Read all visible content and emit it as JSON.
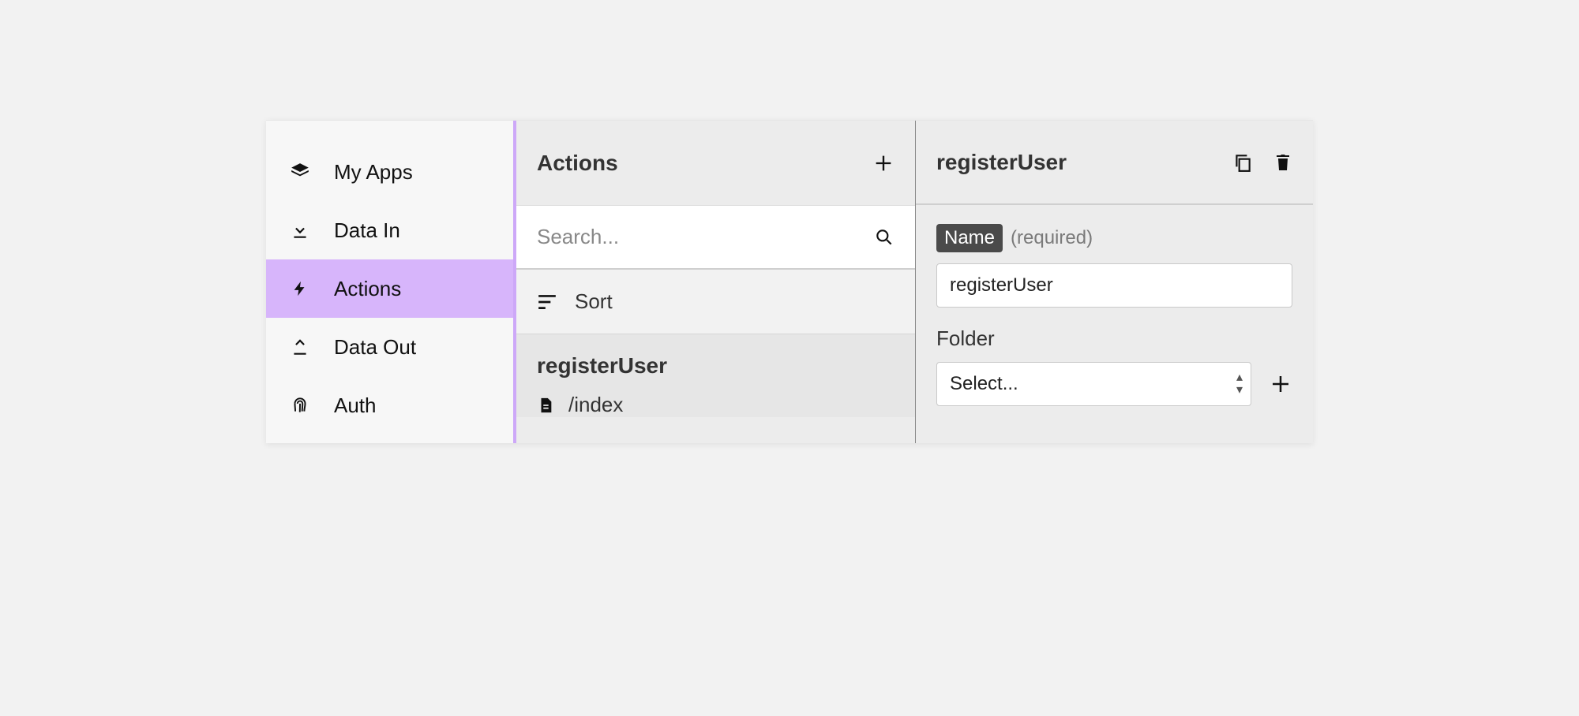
{
  "sidebar": {
    "items": [
      {
        "label": "My Apps",
        "icon": "layers-icon"
      },
      {
        "label": "Data In",
        "icon": "download-icon"
      },
      {
        "label": "Actions",
        "icon": "bolt-icon"
      },
      {
        "label": "Data Out",
        "icon": "upload-icon"
      },
      {
        "label": "Auth",
        "icon": "fingerprint-icon"
      }
    ],
    "active_index": 2
  },
  "middle": {
    "title": "Actions",
    "search_placeholder": "Search...",
    "sort_label": "Sort",
    "group_title": "registerUser",
    "items": [
      {
        "label": "/index"
      }
    ]
  },
  "detail": {
    "title": "registerUser",
    "name_field": {
      "label": "Name",
      "hint": "(required)",
      "value": "registerUser"
    },
    "folder_field": {
      "label": "Folder",
      "placeholder": "Select..."
    }
  }
}
